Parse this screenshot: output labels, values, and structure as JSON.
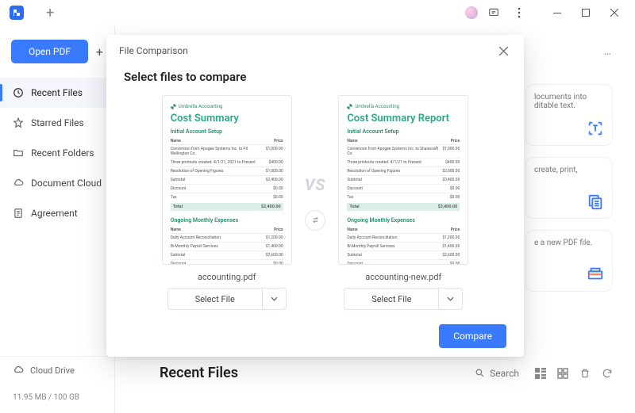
{
  "titlebar": {
    "new_tab_tooltip": "+"
  },
  "sidebar": {
    "open_btn": "Open PDF",
    "plus": "+",
    "items": [
      {
        "label": "Recent Files"
      },
      {
        "label": "Starred Files"
      },
      {
        "label": "Recent Folders"
      },
      {
        "label": "Document Cloud"
      },
      {
        "label": "Agreement"
      }
    ],
    "cloud_label": "Cloud Drive",
    "storage": "11.95 MB / 100 GB"
  },
  "main": {
    "dots": "…",
    "cards": [
      {
        "line1": "locuments into",
        "line2": "ditable text."
      },
      {
        "line1": "create, print,"
      },
      {
        "line1": "e a new PDF file."
      }
    ],
    "recent_title": "Recent Files",
    "search_placeholder": "Search"
  },
  "modal": {
    "header": "File Comparison",
    "title": "Select files to compare",
    "vs": "VS",
    "files": [
      {
        "name": "accounting.pdf",
        "select": "Select File",
        "doc_title": "Cost Summary"
      },
      {
        "name": "accounting-new.pdf",
        "select": "Select File",
        "doc_title": "Cost Summary Report"
      }
    ],
    "compare_btn": "Compare",
    "doc": {
      "brand": "Umbrella Accounting",
      "sec1": "Initial Account Setup",
      "sec2": "Ongoing Monthly Expenses",
      "name_h": "Name",
      "price_h": "Price",
      "total": "Total"
    }
  }
}
